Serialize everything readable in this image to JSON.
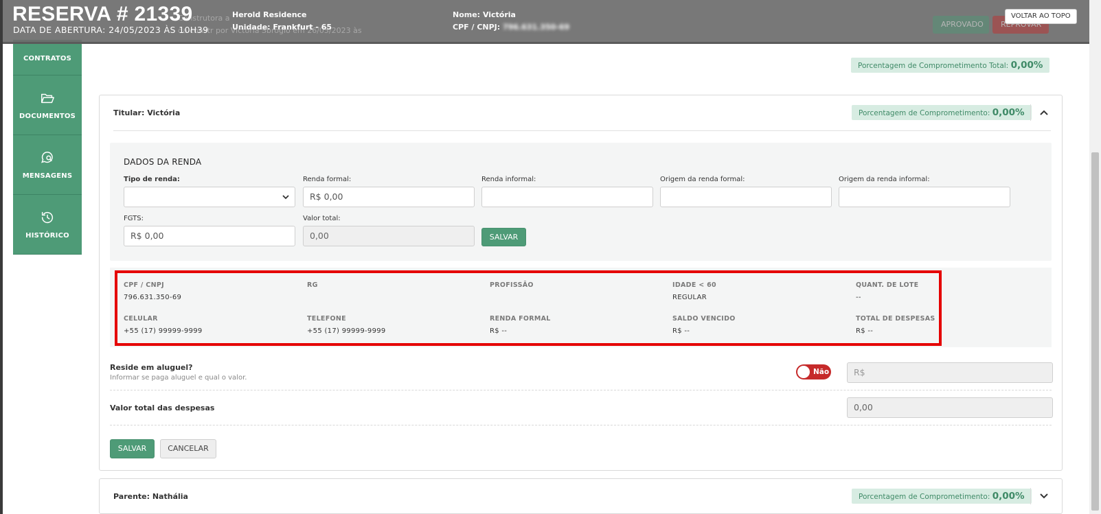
{
  "header": {
    "title": "RESERVA # 21339",
    "opened": "DATA DE ABERTURA: 24/05/2023 ÀS 10H39",
    "project": "Herold Residence",
    "unit_label": "Unidade:",
    "unit_value": "Frankfurt - 65",
    "name_label": "Nome:",
    "name_value": "Victória",
    "cpf_label": "CPF / CNPJ:",
    "cpf_value": "796.631.350-69",
    "back_to_top": "VOLTAR AO TOPO",
    "approved_label": "APROVADO",
    "rejected_label": "REPROVAR",
    "ghost_builder": "Construtora a",
    "ghost_line": "da constr          por Victória Sbrogio em 26/05/2023 às"
  },
  "sidebar": {
    "items": [
      {
        "label": "CONTRATOS",
        "icon": "document-icon"
      },
      {
        "label": "DOCUMENTOS",
        "icon": "folder-open-icon"
      },
      {
        "label": "MENSAGENS",
        "icon": "chat-search-icon"
      },
      {
        "label": "HISTÓRICO",
        "icon": "history-icon"
      }
    ]
  },
  "commitment_total": {
    "label": "Porcentagem de Comprometimento Total:",
    "value": "0,00%"
  },
  "titular": {
    "title": "Titular: Victória",
    "commitment": {
      "label": "Porcentagem de Comprometimento:",
      "value": "0,00%"
    }
  },
  "income": {
    "title": "DADOS DA RENDA",
    "income_type_label": "Tipo de renda:",
    "income_type_value": "",
    "formal_label": "Renda formal:",
    "formal_value": "R$ 0,00",
    "informal_label": "Renda informal:",
    "informal_value": "",
    "formal_origin_label": "Origem da renda formal:",
    "formal_origin_value": "",
    "informal_origin_label": "Origem da renda informal:",
    "informal_origin_value": "",
    "fgts_label": "FGTS:",
    "fgts_value": "R$ 0,00",
    "total_label": "Valor total:",
    "total_value": "0,00",
    "save": "SALVAR"
  },
  "info": {
    "cpf_label": "CPF / CNPJ",
    "cpf_value": "796.631.350-69",
    "rg_label": "RG",
    "rg_value": "",
    "job_label": "PROFISSÃO",
    "job_value": "",
    "age_label": "IDADE < 60",
    "age_value": "REGULAR",
    "lots_label": "QUANT. DE LOTE",
    "lots_value": "--",
    "cell_label": "CELULAR",
    "cell_value": "+55 (17) 99999-9999",
    "phone_label": "TELEFONE",
    "phone_value": "+55 (17) 99999-9999",
    "formal_label": "RENDA FORMAL",
    "formal_value": "R$ --",
    "overdue_label": "SALDO VENCIDO",
    "overdue_value": "R$ --",
    "expenses_label": "TOTAL DE DESPESAS",
    "expenses_value": "R$ --"
  },
  "rent": {
    "title": "Reside em aluguel?",
    "hint": "Informar se paga aluguel e qual o valor.",
    "toggle_label": "Não",
    "toggle_on": false,
    "value_placeholder": "R$"
  },
  "expenses": {
    "title": "Valor total das despesas",
    "value": "0,00"
  },
  "actions": {
    "save": "SALVAR",
    "cancel": "CANCELAR"
  },
  "parente": {
    "title": "Parente: Nathália",
    "commitment": {
      "label": "Porcentagem de Comprometimento:",
      "value": "0,00%"
    }
  },
  "colors": {
    "accent": "#4e9b77",
    "badge_bg": "#d7ece2",
    "danger": "#c62a2a",
    "highlight": "#e50000"
  }
}
